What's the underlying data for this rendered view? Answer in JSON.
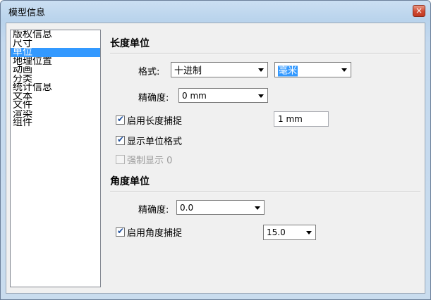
{
  "window": {
    "title": "模型信息",
    "close_glyph": "×"
  },
  "sidebar": {
    "items": [
      "版权信息",
      "尺寸",
      "单位",
      "地理位置",
      "动画",
      "分类",
      "统计信息",
      "文本",
      "文件",
      "渲染",
      "组件"
    ],
    "selected": "单位"
  },
  "length": {
    "heading": "长度单位",
    "format_label": "格式:",
    "format_value": "十进制",
    "unit_value": "毫米",
    "precision_label": "精确度:",
    "precision_value": "0 mm",
    "snap_label": "启用长度捕捉",
    "snap_checked": true,
    "snap_value": "1 mm",
    "show_format_label": "显示单位格式",
    "show_format_checked": true,
    "force_label": "强制显示 0",
    "force_checked": false
  },
  "angle": {
    "heading": "角度单位",
    "precision_label": "精确度:",
    "precision_value": "0.0",
    "snap_label": "启用角度捕捉",
    "snap_checked": true,
    "snap_value": "15.0"
  }
}
